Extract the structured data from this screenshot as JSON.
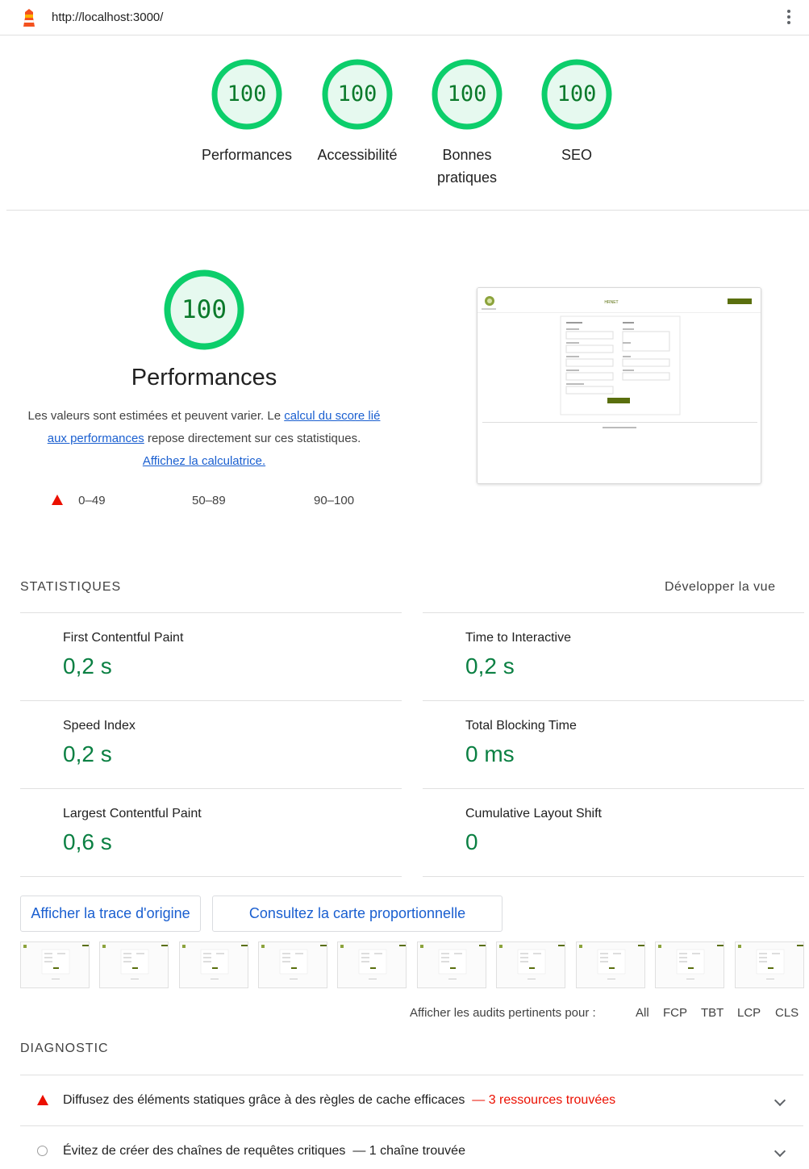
{
  "topbar": {
    "url": "http://localhost:3000/"
  },
  "summary": {
    "gauges": [
      {
        "score": "100",
        "label": "Performances"
      },
      {
        "score": "100",
        "label": "Accessibilité"
      },
      {
        "score": "100",
        "label": "Bonnes pratiques"
      },
      {
        "score": "100",
        "label": "SEO"
      }
    ]
  },
  "performance": {
    "score": "100",
    "title": "Performances",
    "desc_part1": "Les valeurs sont estimées et peuvent varier. Le ",
    "desc_link1": "calcul du score lié aux performances",
    "desc_part2": " repose directement sur ces statistiques. ",
    "desc_link2": "Affichez la calculatrice.",
    "legend": {
      "fail": "0–49",
      "average": "50–89",
      "pass": "90–100"
    }
  },
  "statistics": {
    "heading": "STATISTIQUES",
    "expand_label": "Développer la vue",
    "metrics": [
      {
        "name": "First Contentful Paint",
        "value": "0,2 s"
      },
      {
        "name": "Time to Interactive",
        "value": "0,2 s"
      },
      {
        "name": "Speed Index",
        "value": "0,2 s"
      },
      {
        "name": "Total Blocking Time",
        "value": "0 ms"
      },
      {
        "name": "Largest Contentful Paint",
        "value": "0,6 s"
      },
      {
        "name": "Cumulative Layout Shift",
        "value": "0"
      }
    ]
  },
  "buttons": {
    "trace": "Afficher la trace d'origine",
    "treemap": "Consultez la carte proportionnelle"
  },
  "filter": {
    "label": "Afficher les audits pertinents pour :",
    "all": "All",
    "options": [
      "FCP",
      "TBT",
      "LCP",
      "CLS"
    ]
  },
  "diagnostics": {
    "heading": "DIAGNOSTIC",
    "items": [
      {
        "title": "Diffusez des éléments statiques grâce à des règles de cache efficaces",
        "detail": "3 ressources trouvées"
      },
      {
        "title": "Évitez de créer des chaînes de requêtes critiques",
        "detail": "1 chaîne trouvée"
      }
    ]
  },
  "thumbnail": {
    "brand": "HRNET"
  },
  "colors": {
    "pass": "#0cce6b",
    "pass_text": "#0b8043",
    "fail": "#eb0f00",
    "link": "#1a5fd0"
  }
}
